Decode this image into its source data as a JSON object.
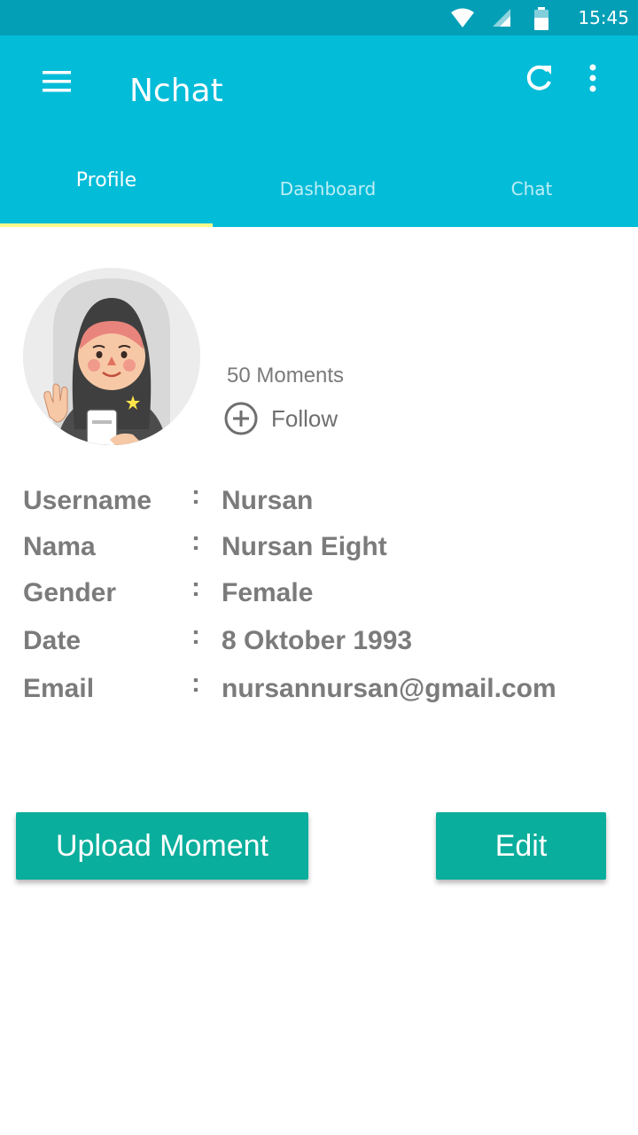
{
  "status_bar": {
    "time": "15:45"
  },
  "app": {
    "title": "Nchat"
  },
  "tabs": [
    {
      "label": "Profile",
      "active": true
    },
    {
      "label": "Dashboard",
      "active": false
    },
    {
      "label": "Chat",
      "active": false
    }
  ],
  "profile": {
    "moments": "50 Moments",
    "follow_label": "Follow",
    "fields": [
      {
        "label": "Username",
        "colon": ":",
        "value": "Nursan"
      },
      {
        "label": "Nama",
        "colon": ":",
        "value": "Nursan Eight"
      },
      {
        "label": "Gender",
        "colon": ":",
        "value": "Female"
      },
      {
        "label": "Date",
        "colon": ":",
        "value": "8 Oktober 1993"
      },
      {
        "label": "Email",
        "colon": ":",
        "value": "nursannursan@gmail.com"
      }
    ]
  },
  "actions": {
    "upload_label": "Upload Moment",
    "edit_label": "Edit"
  },
  "colors": {
    "primary": "#03bcd8",
    "primary_dark": "#039fb6",
    "accent": "#0aae9c",
    "indicator": "#fff98a"
  },
  "icons": [
    "wifi-icon",
    "signal-icon",
    "battery-icon",
    "menu-icon",
    "refresh-icon",
    "more-vert-icon",
    "add-circle-icon"
  ]
}
